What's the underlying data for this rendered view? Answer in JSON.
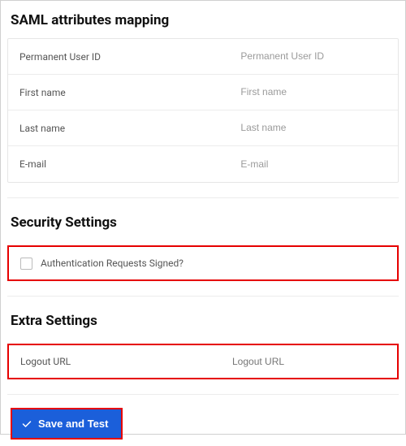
{
  "saml": {
    "title": "SAML attributes mapping",
    "rows": [
      {
        "label": "Permanent User ID",
        "placeholder": "Permanent User ID"
      },
      {
        "label": "First name",
        "placeholder": "First name"
      },
      {
        "label": "Last name",
        "placeholder": "Last name"
      },
      {
        "label": "E-mail",
        "placeholder": "E-mail"
      }
    ]
  },
  "security": {
    "title": "Security Settings",
    "checkbox_label": "Authentication Requests Signed?"
  },
  "extra": {
    "title": "Extra Settings",
    "logout_label": "Logout URL",
    "logout_placeholder": "Logout URL"
  },
  "actions": {
    "save_label": "Save and Test"
  },
  "colors": {
    "highlight": "#e60000",
    "primary": "#1b5fda"
  }
}
